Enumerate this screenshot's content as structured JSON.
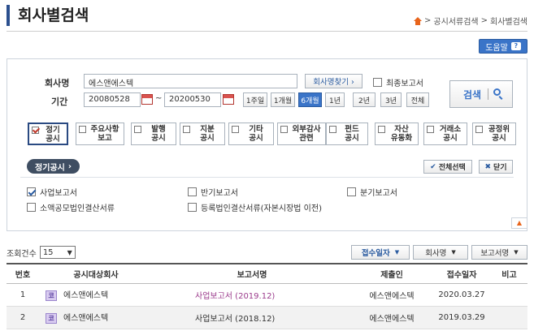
{
  "page": {
    "title": "회사별검색"
  },
  "breadcrumb": {
    "level1": "공시서류검색",
    "level2": "회사별검색",
    "sep": ">"
  },
  "help": {
    "label": "도움말",
    "icon_text": "?"
  },
  "search": {
    "company_label": "회사명",
    "company_value": "에스앤에스텍",
    "find_company_btn": "회사명찾기 ›",
    "final_report_label": "최종보고서",
    "final_report_checked": false,
    "period_label": "기간",
    "date_from": "20080528",
    "date_sep": "~",
    "date_to": "20200530",
    "quick_periods": [
      "1주일",
      "1개월",
      "6개월",
      "1년",
      "2년",
      "3년",
      "전체"
    ],
    "quick_selected": "6개월",
    "search_btn": "검색"
  },
  "categories": [
    {
      "line1": "정기",
      "line2": "공시",
      "checked": true
    },
    {
      "line1": "주요사항",
      "line2": "보고",
      "checked": false
    },
    {
      "line1": "발행",
      "line2": "공시",
      "checked": false
    },
    {
      "line1": "지분",
      "line2": "공시",
      "checked": false
    },
    {
      "line1": "기타",
      "line2": "공시",
      "checked": false
    },
    {
      "line1": "외부감사",
      "line2": "관련",
      "checked": false
    },
    {
      "line1": "펀드",
      "line2": "공시",
      "checked": false
    },
    {
      "line1": "자산",
      "line2": "유동화",
      "checked": false
    },
    {
      "line1": "거래소",
      "line2": "공시",
      "checked": false
    },
    {
      "line1": "공정위",
      "line2": "공시",
      "checked": false
    }
  ],
  "detail": {
    "section_label": "정기공시",
    "select_all_btn": "전체선택",
    "close_btn": "닫기",
    "options": [
      {
        "label": "사업보고서",
        "checked": true
      },
      {
        "label": "반기보고서",
        "checked": false
      },
      {
        "label": "분기보고서",
        "checked": false
      },
      {
        "label": "소액공모법인결산서류",
        "checked": false
      },
      {
        "label": "등록법인결산서류(자본시장법 이전)",
        "checked": false
      }
    ]
  },
  "results": {
    "count_label": "조회건수",
    "page_size": "15",
    "sort_buttons": [
      {
        "label": "접수일자",
        "active": true
      },
      {
        "label": "회사명",
        "active": false
      },
      {
        "label": "보고서명",
        "active": false
      }
    ],
    "columns": [
      "번호",
      "공시대상회사",
      "보고서명",
      "제출인",
      "접수일자",
      "비고"
    ],
    "rows": [
      {
        "no": "1",
        "corp_badge": "코",
        "company": "에스앤에스텍",
        "report": "사업보고서 (2019.12)",
        "submitter": "에스앤에스텍",
        "date": "2020.03.27",
        "note": ""
      },
      {
        "no": "2",
        "corp_badge": "코",
        "company": "에스앤에스텍",
        "report": "사업보고서 (2018.12)",
        "submitter": "에스앤에스텍",
        "date": "2019.03.29",
        "note": ""
      }
    ]
  },
  "colors": {
    "accent": "#3a74c8",
    "title_bar": "#2b4f8e",
    "link": "#9b3b8c",
    "home": "#e8641b"
  }
}
